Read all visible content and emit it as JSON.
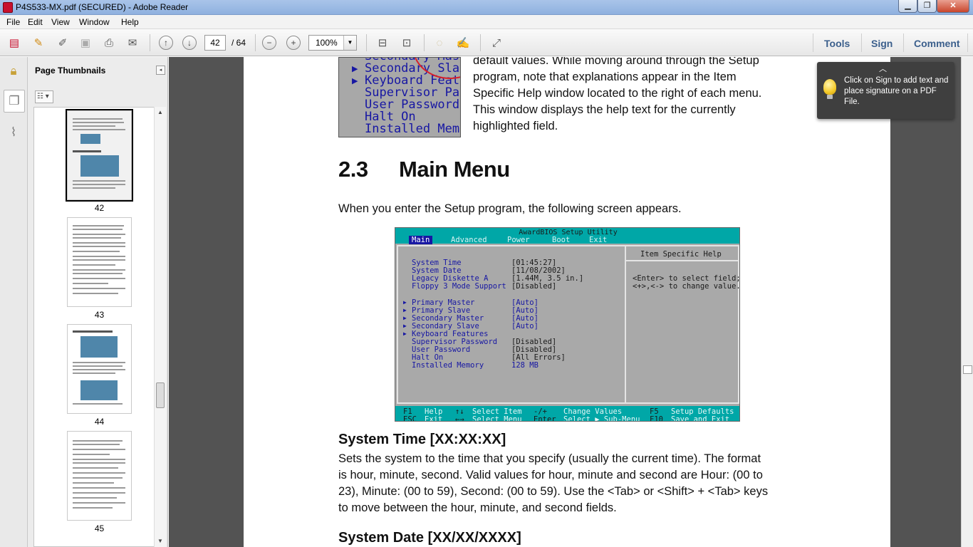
{
  "window": {
    "title": "P4S533-MX.pdf (SECURED) - Adobe Reader",
    "min": "▁",
    "max": "❐",
    "close": "✕"
  },
  "menu": [
    "File",
    "Edit",
    "View",
    "Window",
    "Help"
  ],
  "toolbar": {
    "page_current": "42",
    "page_total": "/ 64",
    "zoom": "100%",
    "zoom_dd": "▼",
    "tools": "Tools",
    "sign": "Sign",
    "comment": "Comment",
    "zoom_out": "−",
    "zoom_in": "+"
  },
  "sidebar": {
    "title": "Page Thumbnails",
    "collapse": "◂",
    "options": "☷ ▾",
    "thumbnails": [
      {
        "label": "42",
        "current": true
      },
      {
        "label": "43",
        "current": false
      },
      {
        "label": "44",
        "current": false
      },
      {
        "label": "45",
        "current": false
      }
    ]
  },
  "document": {
    "crop_rows": [
      "Secondary Mast",
      "Secondary Slav",
      "Keyboard Featu",
      "Supervisor Pas",
      "User Password",
      "Halt On",
      "Installed Memo"
    ],
    "intro_lines": [
      "default values. While moving around through the Setup",
      "program, note that explanations appear in the Item",
      "Specific Help window located to the right of each menu.",
      "This window displays the help text for the currently",
      "highlighted field."
    ],
    "section_num": "2.3",
    "section_title": "Main Menu",
    "lead": "When you enter the Setup program, the following screen appears.",
    "system_time_heading": "System Time [XX:XX:XX]",
    "system_time_lines": [
      "Sets the system to the time that you specify (usually the current time). The format",
      "is hour, minute, second. Valid values for hour, minute and second are Hour: (00 to",
      "23), Minute: (00 to 59), Second: (00 to 59). Use the <Tab> or <Shift> + <Tab> keys",
      "to move between the hour, minute, and second fields."
    ],
    "system_date_heading": "System Date [XX/XX/XXXX]"
  },
  "bios": {
    "title": "AwardBIOS Setup Utility",
    "menus": [
      "Main",
      "Advanced",
      "Power",
      "Boot",
      "Exit"
    ],
    "help_title": "Item Specific Help",
    "help_lines": [
      "<Enter> to select field;",
      "<+>,<-> to change value."
    ],
    "items": [
      {
        "name": "System Time",
        "value": "[01:45:27]"
      },
      {
        "name": "System Date",
        "value": "[11/08/2002]"
      },
      {
        "name": "Legacy Diskette A",
        "value": "[1.44M, 3.5 in.]"
      },
      {
        "name": "Floppy 3 Mode Support",
        "value": "[Disabled]"
      },
      {
        "name": "Primary Master",
        "value": "[Auto]"
      },
      {
        "name": "Primary Slave",
        "value": "[Auto]"
      },
      {
        "name": "Secondary Master",
        "value": "[Auto]"
      },
      {
        "name": "Secondary Slave",
        "value": "[Auto]"
      },
      {
        "name": "Keyboard Features",
        "value": ""
      },
      {
        "name": "Supervisor Password",
        "value": "[Disabled]"
      },
      {
        "name": "User Password",
        "value": "[Disabled]"
      },
      {
        "name": "Halt On",
        "value": "[All Errors]"
      },
      {
        "name": "Installed Memory",
        "value": "128 MB"
      }
    ],
    "footer_keys_1": [
      "F1",
      "↑↓",
      "-/+",
      "F5"
    ],
    "footer_desc_1": [
      "Help",
      "Select Item",
      "Change Values",
      "Setup Defaults"
    ],
    "footer_keys_2": [
      "ESC",
      "←→",
      "Enter",
      "F10"
    ],
    "footer_desc_2": [
      "Exit",
      "Select Menu",
      "Select ▶ Sub-Menu",
      "Save and Exit"
    ]
  },
  "tooltip": {
    "text": "Click on Sign to add text and place signature on a PDF File."
  }
}
